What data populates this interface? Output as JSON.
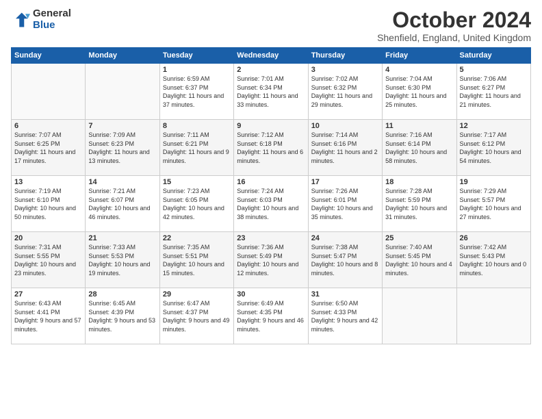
{
  "logo": {
    "general": "General",
    "blue": "Blue"
  },
  "title": "October 2024",
  "location": "Shenfield, England, United Kingdom",
  "weekdays": [
    "Sunday",
    "Monday",
    "Tuesday",
    "Wednesday",
    "Thursday",
    "Friday",
    "Saturday"
  ],
  "weeks": [
    [
      {
        "day": "",
        "sunrise": "",
        "sunset": "",
        "daylight": ""
      },
      {
        "day": "",
        "sunrise": "",
        "sunset": "",
        "daylight": ""
      },
      {
        "day": "1",
        "sunrise": "Sunrise: 6:59 AM",
        "sunset": "Sunset: 6:37 PM",
        "daylight": "Daylight: 11 hours and 37 minutes."
      },
      {
        "day": "2",
        "sunrise": "Sunrise: 7:01 AM",
        "sunset": "Sunset: 6:34 PM",
        "daylight": "Daylight: 11 hours and 33 minutes."
      },
      {
        "day": "3",
        "sunrise": "Sunrise: 7:02 AM",
        "sunset": "Sunset: 6:32 PM",
        "daylight": "Daylight: 11 hours and 29 minutes."
      },
      {
        "day": "4",
        "sunrise": "Sunrise: 7:04 AM",
        "sunset": "Sunset: 6:30 PM",
        "daylight": "Daylight: 11 hours and 25 minutes."
      },
      {
        "day": "5",
        "sunrise": "Sunrise: 7:06 AM",
        "sunset": "Sunset: 6:27 PM",
        "daylight": "Daylight: 11 hours and 21 minutes."
      }
    ],
    [
      {
        "day": "6",
        "sunrise": "Sunrise: 7:07 AM",
        "sunset": "Sunset: 6:25 PM",
        "daylight": "Daylight: 11 hours and 17 minutes."
      },
      {
        "day": "7",
        "sunrise": "Sunrise: 7:09 AM",
        "sunset": "Sunset: 6:23 PM",
        "daylight": "Daylight: 11 hours and 13 minutes."
      },
      {
        "day": "8",
        "sunrise": "Sunrise: 7:11 AM",
        "sunset": "Sunset: 6:21 PM",
        "daylight": "Daylight: 11 hours and 9 minutes."
      },
      {
        "day": "9",
        "sunrise": "Sunrise: 7:12 AM",
        "sunset": "Sunset: 6:18 PM",
        "daylight": "Daylight: 11 hours and 6 minutes."
      },
      {
        "day": "10",
        "sunrise": "Sunrise: 7:14 AM",
        "sunset": "Sunset: 6:16 PM",
        "daylight": "Daylight: 11 hours and 2 minutes."
      },
      {
        "day": "11",
        "sunrise": "Sunrise: 7:16 AM",
        "sunset": "Sunset: 6:14 PM",
        "daylight": "Daylight: 10 hours and 58 minutes."
      },
      {
        "day": "12",
        "sunrise": "Sunrise: 7:17 AM",
        "sunset": "Sunset: 6:12 PM",
        "daylight": "Daylight: 10 hours and 54 minutes."
      }
    ],
    [
      {
        "day": "13",
        "sunrise": "Sunrise: 7:19 AM",
        "sunset": "Sunset: 6:10 PM",
        "daylight": "Daylight: 10 hours and 50 minutes."
      },
      {
        "day": "14",
        "sunrise": "Sunrise: 7:21 AM",
        "sunset": "Sunset: 6:07 PM",
        "daylight": "Daylight: 10 hours and 46 minutes."
      },
      {
        "day": "15",
        "sunrise": "Sunrise: 7:23 AM",
        "sunset": "Sunset: 6:05 PM",
        "daylight": "Daylight: 10 hours and 42 minutes."
      },
      {
        "day": "16",
        "sunrise": "Sunrise: 7:24 AM",
        "sunset": "Sunset: 6:03 PM",
        "daylight": "Daylight: 10 hours and 38 minutes."
      },
      {
        "day": "17",
        "sunrise": "Sunrise: 7:26 AM",
        "sunset": "Sunset: 6:01 PM",
        "daylight": "Daylight: 10 hours and 35 minutes."
      },
      {
        "day": "18",
        "sunrise": "Sunrise: 7:28 AM",
        "sunset": "Sunset: 5:59 PM",
        "daylight": "Daylight: 10 hours and 31 minutes."
      },
      {
        "day": "19",
        "sunrise": "Sunrise: 7:29 AM",
        "sunset": "Sunset: 5:57 PM",
        "daylight": "Daylight: 10 hours and 27 minutes."
      }
    ],
    [
      {
        "day": "20",
        "sunrise": "Sunrise: 7:31 AM",
        "sunset": "Sunset: 5:55 PM",
        "daylight": "Daylight: 10 hours and 23 minutes."
      },
      {
        "day": "21",
        "sunrise": "Sunrise: 7:33 AM",
        "sunset": "Sunset: 5:53 PM",
        "daylight": "Daylight: 10 hours and 19 minutes."
      },
      {
        "day": "22",
        "sunrise": "Sunrise: 7:35 AM",
        "sunset": "Sunset: 5:51 PM",
        "daylight": "Daylight: 10 hours and 15 minutes."
      },
      {
        "day": "23",
        "sunrise": "Sunrise: 7:36 AM",
        "sunset": "Sunset: 5:49 PM",
        "daylight": "Daylight: 10 hours and 12 minutes."
      },
      {
        "day": "24",
        "sunrise": "Sunrise: 7:38 AM",
        "sunset": "Sunset: 5:47 PM",
        "daylight": "Daylight: 10 hours and 8 minutes."
      },
      {
        "day": "25",
        "sunrise": "Sunrise: 7:40 AM",
        "sunset": "Sunset: 5:45 PM",
        "daylight": "Daylight: 10 hours and 4 minutes."
      },
      {
        "day": "26",
        "sunrise": "Sunrise: 7:42 AM",
        "sunset": "Sunset: 5:43 PM",
        "daylight": "Daylight: 10 hours and 0 minutes."
      }
    ],
    [
      {
        "day": "27",
        "sunrise": "Sunrise: 6:43 AM",
        "sunset": "Sunset: 4:41 PM",
        "daylight": "Daylight: 9 hours and 57 minutes."
      },
      {
        "day": "28",
        "sunrise": "Sunrise: 6:45 AM",
        "sunset": "Sunset: 4:39 PM",
        "daylight": "Daylight: 9 hours and 53 minutes."
      },
      {
        "day": "29",
        "sunrise": "Sunrise: 6:47 AM",
        "sunset": "Sunset: 4:37 PM",
        "daylight": "Daylight: 9 hours and 49 minutes."
      },
      {
        "day": "30",
        "sunrise": "Sunrise: 6:49 AM",
        "sunset": "Sunset: 4:35 PM",
        "daylight": "Daylight: 9 hours and 46 minutes."
      },
      {
        "day": "31",
        "sunrise": "Sunrise: 6:50 AM",
        "sunset": "Sunset: 4:33 PM",
        "daylight": "Daylight: 9 hours and 42 minutes."
      },
      {
        "day": "",
        "sunrise": "",
        "sunset": "",
        "daylight": ""
      },
      {
        "day": "",
        "sunrise": "",
        "sunset": "",
        "daylight": ""
      }
    ]
  ]
}
